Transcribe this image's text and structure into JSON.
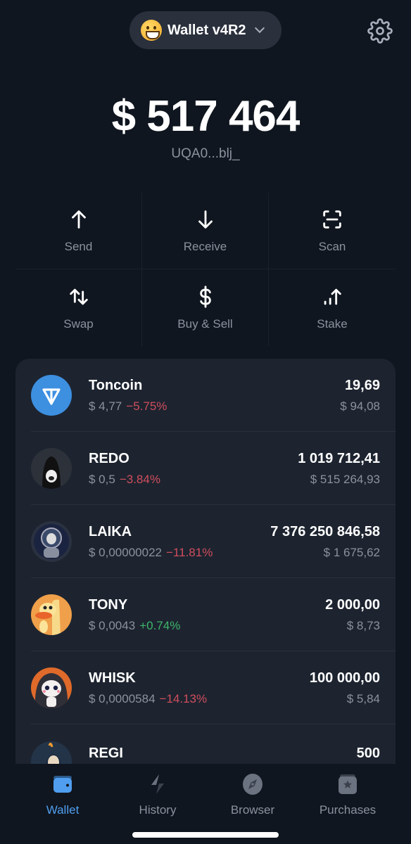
{
  "header": {
    "wallet_emoji": "grinning-face",
    "wallet_name": "Wallet v4R2",
    "settings_icon": "gear-icon"
  },
  "balance": {
    "total": "$ 517 464",
    "address": "UQA0...blj_"
  },
  "actions": [
    {
      "label": "Send",
      "icon": "arrow-up-icon"
    },
    {
      "label": "Receive",
      "icon": "arrow-down-icon"
    },
    {
      "label": "Scan",
      "icon": "scan-icon"
    },
    {
      "label": "Swap",
      "icon": "swap-icon"
    },
    {
      "label": "Buy & Sell",
      "icon": "dollar-icon"
    },
    {
      "label": "Stake",
      "icon": "stake-icon"
    }
  ],
  "tokens": [
    {
      "name": "Toncoin",
      "price": "$ 4,77",
      "change": "−5.75%",
      "change_dir": "down",
      "amount": "19,69",
      "usd": "$ 94,08",
      "color": "#3d8fe0"
    },
    {
      "name": "REDO",
      "price": "$ 0,5",
      "change": "−3.84%",
      "change_dir": "down",
      "amount": "1 019 712,41",
      "usd": "$ 515 264,93",
      "color": "#2d323a"
    },
    {
      "name": "LAIKA",
      "price": "$ 0,00000022",
      "change": "−11.81%",
      "change_dir": "down",
      "amount": "7 376 250 846,58",
      "usd": "$ 1 675,62",
      "color": "#1e2a4a"
    },
    {
      "name": "TONY",
      "price": "$ 0,0043",
      "change": "+0.74%",
      "change_dir": "up",
      "amount": "2 000,00",
      "usd": "$ 8,73",
      "color": "#f0a04a"
    },
    {
      "name": "WHISK",
      "price": "$ 0,0000584",
      "change": "−14.13%",
      "change_dir": "down",
      "amount": "100 000,00",
      "usd": "$ 5,84",
      "color": "#2b2f38"
    },
    {
      "name": "REGI",
      "price": "",
      "change": "",
      "change_dir": "",
      "amount": "500",
      "usd": "",
      "color": "#243448"
    }
  ],
  "tabbar": {
    "tabs": [
      {
        "label": "Wallet",
        "icon": "wallet-icon",
        "active": true
      },
      {
        "label": "History",
        "icon": "lightning-icon",
        "active": false
      },
      {
        "label": "Browser",
        "icon": "compass-icon",
        "active": false
      },
      {
        "label": "Purchases",
        "icon": "purchases-icon",
        "active": false
      }
    ]
  },
  "colors": {
    "background": "#10161f",
    "card": "#1d2430",
    "accent": "#4f9ef0",
    "negative": "#d04d5c",
    "positive": "#3fb46a",
    "muted": "#8b929e"
  }
}
